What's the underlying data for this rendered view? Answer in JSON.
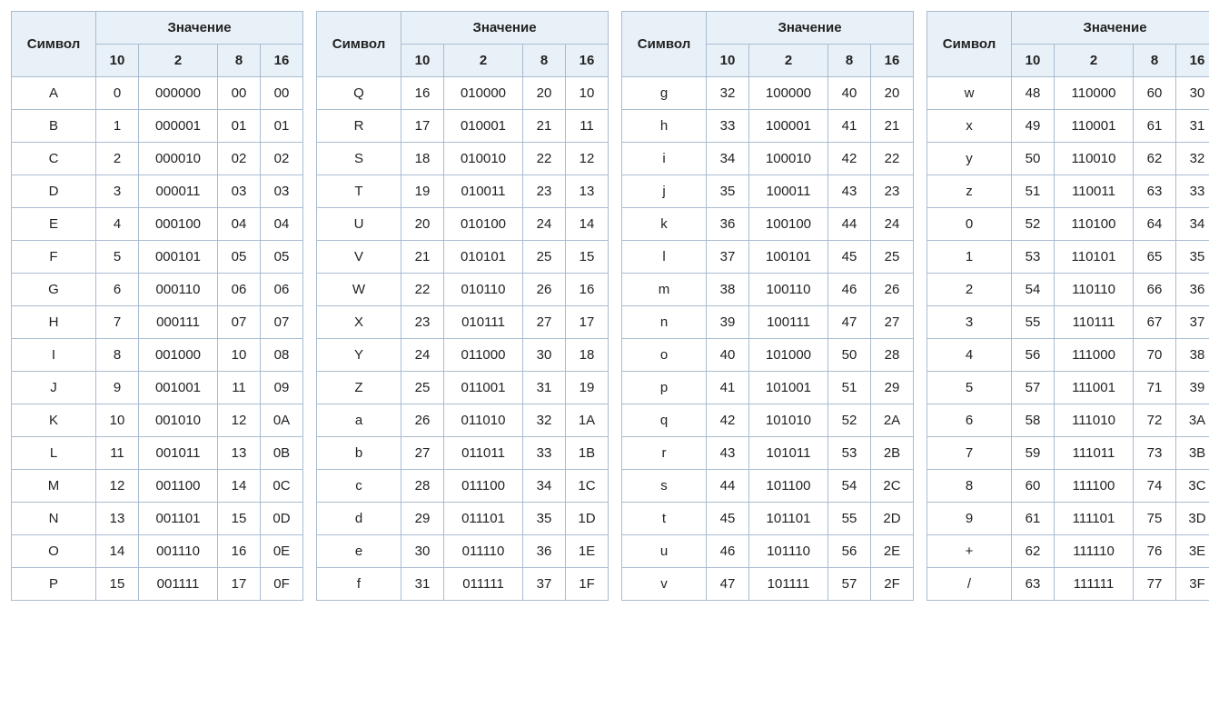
{
  "headers": {
    "symbol": "Символ",
    "value": "Значение",
    "base10": "10",
    "base2": "2",
    "base8": "8",
    "base16": "16"
  },
  "panels": [
    {
      "rows": [
        {
          "sym": "A",
          "d": "0",
          "b": "000000",
          "o": "00",
          "h": "00"
        },
        {
          "sym": "B",
          "d": "1",
          "b": "000001",
          "o": "01",
          "h": "01"
        },
        {
          "sym": "C",
          "d": "2",
          "b": "000010",
          "o": "02",
          "h": "02"
        },
        {
          "sym": "D",
          "d": "3",
          "b": "000011",
          "o": "03",
          "h": "03"
        },
        {
          "sym": "E",
          "d": "4",
          "b": "000100",
          "o": "04",
          "h": "04"
        },
        {
          "sym": "F",
          "d": "5",
          "b": "000101",
          "o": "05",
          "h": "05"
        },
        {
          "sym": "G",
          "d": "6",
          "b": "000110",
          "o": "06",
          "h": "06"
        },
        {
          "sym": "H",
          "d": "7",
          "b": "000111",
          "o": "07",
          "h": "07"
        },
        {
          "sym": "I",
          "d": "8",
          "b": "001000",
          "o": "10",
          "h": "08"
        },
        {
          "sym": "J",
          "d": "9",
          "b": "001001",
          "o": "11",
          "h": "09"
        },
        {
          "sym": "K",
          "d": "10",
          "b": "001010",
          "o": "12",
          "h": "0A"
        },
        {
          "sym": "L",
          "d": "11",
          "b": "001011",
          "o": "13",
          "h": "0B"
        },
        {
          "sym": "M",
          "d": "12",
          "b": "001100",
          "o": "14",
          "h": "0C"
        },
        {
          "sym": "N",
          "d": "13",
          "b": "001101",
          "o": "15",
          "h": "0D"
        },
        {
          "sym": "O",
          "d": "14",
          "b": "001110",
          "o": "16",
          "h": "0E"
        },
        {
          "sym": "P",
          "d": "15",
          "b": "001111",
          "o": "17",
          "h": "0F"
        }
      ]
    },
    {
      "rows": [
        {
          "sym": "Q",
          "d": "16",
          "b": "010000",
          "o": "20",
          "h": "10"
        },
        {
          "sym": "R",
          "d": "17",
          "b": "010001",
          "o": "21",
          "h": "11"
        },
        {
          "sym": "S",
          "d": "18",
          "b": "010010",
          "o": "22",
          "h": "12"
        },
        {
          "sym": "T",
          "d": "19",
          "b": "010011",
          "o": "23",
          "h": "13"
        },
        {
          "sym": "U",
          "d": "20",
          "b": "010100",
          "o": "24",
          "h": "14"
        },
        {
          "sym": "V",
          "d": "21",
          "b": "010101",
          "o": "25",
          "h": "15"
        },
        {
          "sym": "W",
          "d": "22",
          "b": "010110",
          "o": "26",
          "h": "16"
        },
        {
          "sym": "X",
          "d": "23",
          "b": "010111",
          "o": "27",
          "h": "17"
        },
        {
          "sym": "Y",
          "d": "24",
          "b": "011000",
          "o": "30",
          "h": "18"
        },
        {
          "sym": "Z",
          "d": "25",
          "b": "011001",
          "o": "31",
          "h": "19"
        },
        {
          "sym": "a",
          "d": "26",
          "b": "011010",
          "o": "32",
          "h": "1A"
        },
        {
          "sym": "b",
          "d": "27",
          "b": "011011",
          "o": "33",
          "h": "1B"
        },
        {
          "sym": "c",
          "d": "28",
          "b": "011100",
          "o": "34",
          "h": "1C"
        },
        {
          "sym": "d",
          "d": "29",
          "b": "011101",
          "o": "35",
          "h": "1D"
        },
        {
          "sym": "e",
          "d": "30",
          "b": "011110",
          "o": "36",
          "h": "1E"
        },
        {
          "sym": "f",
          "d": "31",
          "b": "011111",
          "o": "37",
          "h": "1F"
        }
      ]
    },
    {
      "rows": [
        {
          "sym": "g",
          "d": "32",
          "b": "100000",
          "o": "40",
          "h": "20"
        },
        {
          "sym": "h",
          "d": "33",
          "b": "100001",
          "o": "41",
          "h": "21"
        },
        {
          "sym": "i",
          "d": "34",
          "b": "100010",
          "o": "42",
          "h": "22"
        },
        {
          "sym": "j",
          "d": "35",
          "b": "100011",
          "o": "43",
          "h": "23"
        },
        {
          "sym": "k",
          "d": "36",
          "b": "100100",
          "o": "44",
          "h": "24"
        },
        {
          "sym": "l",
          "d": "37",
          "b": "100101",
          "o": "45",
          "h": "25"
        },
        {
          "sym": "m",
          "d": "38",
          "b": "100110",
          "o": "46",
          "h": "26"
        },
        {
          "sym": "n",
          "d": "39",
          "b": "100111",
          "o": "47",
          "h": "27"
        },
        {
          "sym": "o",
          "d": "40",
          "b": "101000",
          "o": "50",
          "h": "28"
        },
        {
          "sym": "p",
          "d": "41",
          "b": "101001",
          "o": "51",
          "h": "29"
        },
        {
          "sym": "q",
          "d": "42",
          "b": "101010",
          "o": "52",
          "h": "2A"
        },
        {
          "sym": "r",
          "d": "43",
          "b": "101011",
          "o": "53",
          "h": "2B"
        },
        {
          "sym": "s",
          "d": "44",
          "b": "101100",
          "o": "54",
          "h": "2C"
        },
        {
          "sym": "t",
          "d": "45",
          "b": "101101",
          "o": "55",
          "h": "2D"
        },
        {
          "sym": "u",
          "d": "46",
          "b": "101110",
          "o": "56",
          "h": "2E"
        },
        {
          "sym": "v",
          "d": "47",
          "b": "101111",
          "o": "57",
          "h": "2F"
        }
      ]
    },
    {
      "rows": [
        {
          "sym": "w",
          "d": "48",
          "b": "110000",
          "o": "60",
          "h": "30"
        },
        {
          "sym": "x",
          "d": "49",
          "b": "110001",
          "o": "61",
          "h": "31"
        },
        {
          "sym": "y",
          "d": "50",
          "b": "110010",
          "o": "62",
          "h": "32"
        },
        {
          "sym": "z",
          "d": "51",
          "b": "110011",
          "o": "63",
          "h": "33"
        },
        {
          "sym": "0",
          "d": "52",
          "b": "110100",
          "o": "64",
          "h": "34"
        },
        {
          "sym": "1",
          "d": "53",
          "b": "110101",
          "o": "65",
          "h": "35"
        },
        {
          "sym": "2",
          "d": "54",
          "b": "110110",
          "o": "66",
          "h": "36"
        },
        {
          "sym": "3",
          "d": "55",
          "b": "110111",
          "o": "67",
          "h": "37"
        },
        {
          "sym": "4",
          "d": "56",
          "b": "111000",
          "o": "70",
          "h": "38"
        },
        {
          "sym": "5",
          "d": "57",
          "b": "111001",
          "o": "71",
          "h": "39"
        },
        {
          "sym": "6",
          "d": "58",
          "b": "111010",
          "o": "72",
          "h": "3A"
        },
        {
          "sym": "7",
          "d": "59",
          "b": "111011",
          "o": "73",
          "h": "3B"
        },
        {
          "sym": "8",
          "d": "60",
          "b": "111100",
          "o": "74",
          "h": "3C"
        },
        {
          "sym": "9",
          "d": "61",
          "b": "111101",
          "o": "75",
          "h": "3D"
        },
        {
          "sym": "+",
          "d": "62",
          "b": "111110",
          "o": "76",
          "h": "3E"
        },
        {
          "sym": "/",
          "d": "63",
          "b": "111111",
          "o": "77",
          "h": "3F"
        }
      ]
    }
  ]
}
